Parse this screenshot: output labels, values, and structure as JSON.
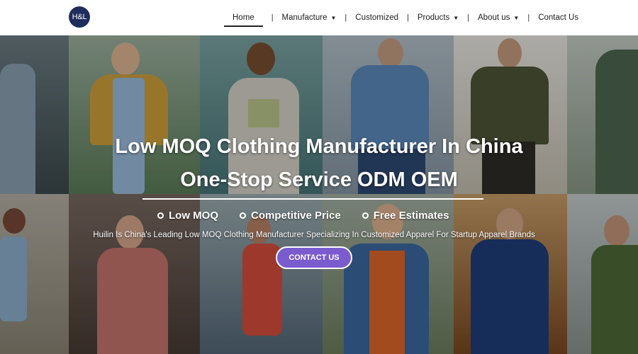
{
  "brand": {
    "logo_text": "H&L"
  },
  "nav": {
    "home": "Home",
    "manufacture": "Manufacture",
    "customized": "Customized",
    "products": "Products",
    "about": "About us",
    "contact": "Contact Us",
    "separator": "|",
    "caret": "▼"
  },
  "hero": {
    "title_line1": "Low MOQ Clothing Manufacturer In China",
    "title_line2": "One-Stop Service ODM OEM",
    "features": [
      "Low MOQ",
      "Competitive Price",
      "Free Estimates"
    ],
    "subtitle": "Huilin Is China's Leading Low MOQ Clothing Manufacturer Specializing In Customized Apparel For Startup Apparel Brands",
    "cta_label": "CONTACT US"
  },
  "colors": {
    "logo_bg": "#1f2d5c",
    "cta_bg": "#7a5ccf",
    "nav_text": "#222222"
  }
}
